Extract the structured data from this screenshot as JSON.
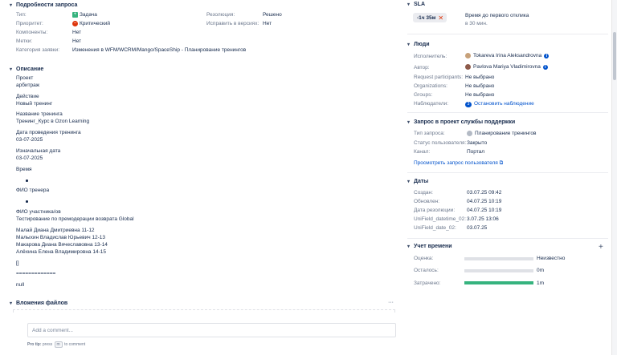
{
  "details": {
    "title": "Подробности запроса",
    "type_label": "Тип:",
    "type_value": "Задача",
    "priority_label": "Приоритет:",
    "priority_value": "Критический",
    "components_label": "Компоненты:",
    "components_value": "Нет",
    "labels_label": "Метки:",
    "labels_value": "Нет",
    "category_label": "Категория заявки:",
    "category_value": "Изменения в WFM/WCRM/Mango/SpaceShip - Планирование тренингов",
    "resolution_label": "Резолюция:",
    "resolution_value": "Решено",
    "fix_label": "Исправить в версиях:",
    "fix_value": "Нет"
  },
  "description": {
    "title": "Описание",
    "lines": [
      "Проект",
      "арбитраж",
      "Действие",
      "Новый тренинг",
      "Название тренинга",
      "Тренинг_Курс в Ozon Learning",
      "Дата проведения тренинга",
      "03-07-2025",
      "Изначальная дата",
      "03-07-2025",
      "Время",
      "ФИО тренера",
      "ФИО участника/ов",
      "Тестирование по премодерации возврата Global",
      "Малай Диана Дмитриевна 11-12",
      "Малыхин Владислав Юрьевич 12-13",
      "Макарова Диана Вячеславовна 13-14",
      "Алёхина Елена Владимировна 14-15",
      "[]",
      "=============",
      "null"
    ]
  },
  "attachments": {
    "title": "Вложения файлов",
    "more": "···"
  },
  "comment": {
    "placeholder": "Add a comment...",
    "tip_bold": "Pro tip:",
    "tip_press": "press",
    "tip_key": "m",
    "tip_rest": "to comment"
  },
  "sla": {
    "title": "SLA",
    "badge": "-1ч 35м",
    "name": "Время до первого отклика",
    "sub": "в 30 мин."
  },
  "people": {
    "title": "Люди",
    "assignee_label": "Исполнитель:",
    "assignee_value": "Tokareva Irina Aleksandrovna",
    "author_label": "Автор:",
    "author_value": "Pavlova Mariya Vladimirovna",
    "participants_label": "Request participants:",
    "participants_value": "Не выбрано",
    "orgs_label": "Organizations:",
    "orgs_value": "Не выбрано",
    "groups_label": "Groups:",
    "groups_value": "Не выбрано",
    "watchers_label": "Наблюдатели:",
    "watchers_count": "3",
    "watchers_action": "Остановить наблюдение"
  },
  "service": {
    "title": "Запрос в проект службы поддержки",
    "req_type_label": "Тип запроса:",
    "req_type_value": "Планирование тренингов",
    "status_label": "Статус пользователя:",
    "status_value": "Закрыто",
    "channel_label": "Канал:",
    "channel_value": "Портал",
    "view_link": "Просмотреть запрос пользователя"
  },
  "dates": {
    "title": "Даты",
    "created_label": "Создан:",
    "created_value": "03.07.25 09:42",
    "updated_label": "Обновлен:",
    "updated_value": "04.07.25 10:19",
    "resolved_label": "Дата резолюции:",
    "resolved_value": "04.07.25 10:19",
    "uf1_label": "UniField_datetime_02:",
    "uf1_value": "3.07.25 13:06",
    "uf2_label": "UniField_date_02:",
    "uf2_value": "03.07.25"
  },
  "time": {
    "title": "Учет времени",
    "add": "+",
    "estimate_label": "Оценка:",
    "estimate_value": "Неизвестно",
    "estimate_fill": 0,
    "remaining_label": "Осталось:",
    "remaining_value": "0m",
    "remaining_fill": 0,
    "spent_label": "Затрачено:",
    "spent_value": "1m",
    "spent_fill": 1
  },
  "colors": {
    "link": "#0052cc",
    "green": "#36b37e",
    "bar_bg": "#dfe1e6",
    "sla_badge_bg": "#ebecf0",
    "priority_red": "#de350b"
  }
}
